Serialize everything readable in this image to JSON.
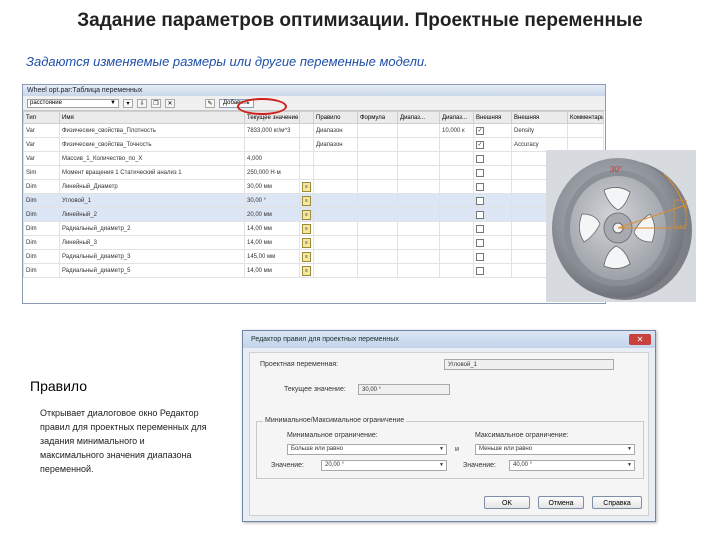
{
  "slide": {
    "title": "Задание параметров оптимизации. Проектные переменные",
    "subtitle": "Задаются изменяемые размеры или другие переменные модели."
  },
  "table_window": {
    "title": "Wheel opt.par:Таблица переменных",
    "filter_value": "расстояние",
    "add_button_label": "Добавить",
    "columns": [
      "Тип",
      "Имя",
      "Текущее значение",
      "",
      "Правило",
      "Формула",
      "Диапаз...",
      "Диапаз...",
      "Внешняя",
      "Внешняя",
      "Комментарий"
    ],
    "rows": [
      {
        "type": "Var",
        "name": "Физические_свойства_Плотность",
        "value": "7833,000 кг/м^3",
        "icon": "",
        "rule": "Диапазон",
        "formula": "",
        "range_min": "",
        "range_max": "10,000 к",
        "ext_check": true,
        "ext_name": "Density",
        "selected": false
      },
      {
        "type": "Var",
        "name": "Физические_свойства_Точность",
        "value": "",
        "icon": "",
        "rule": "Диапазон",
        "formula": "",
        "range_min": "",
        "range_max": "",
        "ext_check": true,
        "ext_name": "Accuracy",
        "selected": false
      },
      {
        "type": "Var",
        "name": "Массив_1_Количество_по_X",
        "value": "4,000",
        "icon": "",
        "rule": "",
        "formula": "",
        "range_min": "",
        "range_max": "",
        "ext_check": false,
        "ext_name": "",
        "selected": false
      },
      {
        "type": "Sim",
        "name": "Момент вращения 1 Статический анализ 1",
        "value": "250,000 Н·м",
        "icon": "",
        "rule": "",
        "formula": "",
        "range_min": "",
        "range_max": "",
        "ext_check": false,
        "ext_name": "",
        "selected": false
      },
      {
        "type": "Dim",
        "name": "Линейный_Диаметр",
        "value": "30,00 мм",
        "icon": "ruler",
        "rule": "",
        "formula": "",
        "range_min": "",
        "range_max": "",
        "ext_check": false,
        "ext_name": "",
        "selected": false
      },
      {
        "type": "Dim",
        "name": "Угловой_1",
        "value": "30,00 °",
        "icon": "ruler",
        "rule": "",
        "formula": "",
        "range_min": "",
        "range_max": "",
        "ext_check": false,
        "ext_name": "",
        "selected": true
      },
      {
        "type": "Dim",
        "name": "Линейный_2",
        "value": "20,00 мм",
        "icon": "ruler",
        "rule": "",
        "formula": "",
        "range_min": "",
        "range_max": "",
        "ext_check": false,
        "ext_name": "",
        "selected": true
      },
      {
        "type": "Dim",
        "name": "Радиальный_диаметр_2",
        "value": "14,00 мм",
        "icon": "ruler",
        "rule": "",
        "formula": "",
        "range_min": "",
        "range_max": "",
        "ext_check": false,
        "ext_name": "",
        "selected": false
      },
      {
        "type": "Dim",
        "name": "Линейный_3",
        "value": "14,00 мм",
        "icon": "ruler",
        "rule": "",
        "formula": "",
        "range_min": "",
        "range_max": "",
        "ext_check": false,
        "ext_name": "",
        "selected": false
      },
      {
        "type": "Dim",
        "name": "Радиальный_диаметр_3",
        "value": "145,00 мм",
        "icon": "ruler",
        "rule": "",
        "formula": "",
        "range_min": "",
        "range_max": "",
        "ext_check": false,
        "ext_name": "",
        "selected": false
      },
      {
        "type": "Dim",
        "name": "Радиальный_диаметр_5",
        "value": "14,00 мм",
        "icon": "ruler",
        "rule": "",
        "formula": "",
        "range_min": "",
        "range_max": "",
        "ext_check": false,
        "ext_name": "",
        "selected": false
      }
    ]
  },
  "model_view": {
    "dimension_label": "30°"
  },
  "rule_panel": {
    "title": "Правило",
    "description": "Открывает диалоговое окно Редактор правил для проектных переменных для задания минимального и максимального значения диапазона переменной."
  },
  "dialog": {
    "title": "Редактор правил для проектных переменных",
    "variable_label": "Проектная переменная:",
    "variable_value": "Угловой_1",
    "current_label": "Текущее значение:",
    "current_value": "30,00 °",
    "group_label": "Минимальное/Максимальное ограничение",
    "min_label": "Минимальное ограничение:",
    "min_condition": "Больше или равно",
    "and_label": "и",
    "max_label": "Максимальное ограничение:",
    "max_condition": "Меньше или равно",
    "value_label_left": "Значение:",
    "min_value": "20,00 °",
    "value_label_right": "Значение:",
    "max_value": "40,00 °",
    "ok": "OK",
    "cancel": "Отмена",
    "help": "Справка"
  },
  "colors": {
    "accent": "#1f4fa8",
    "highlight_circle": "#d0201e",
    "selection": "#dde6f4"
  }
}
